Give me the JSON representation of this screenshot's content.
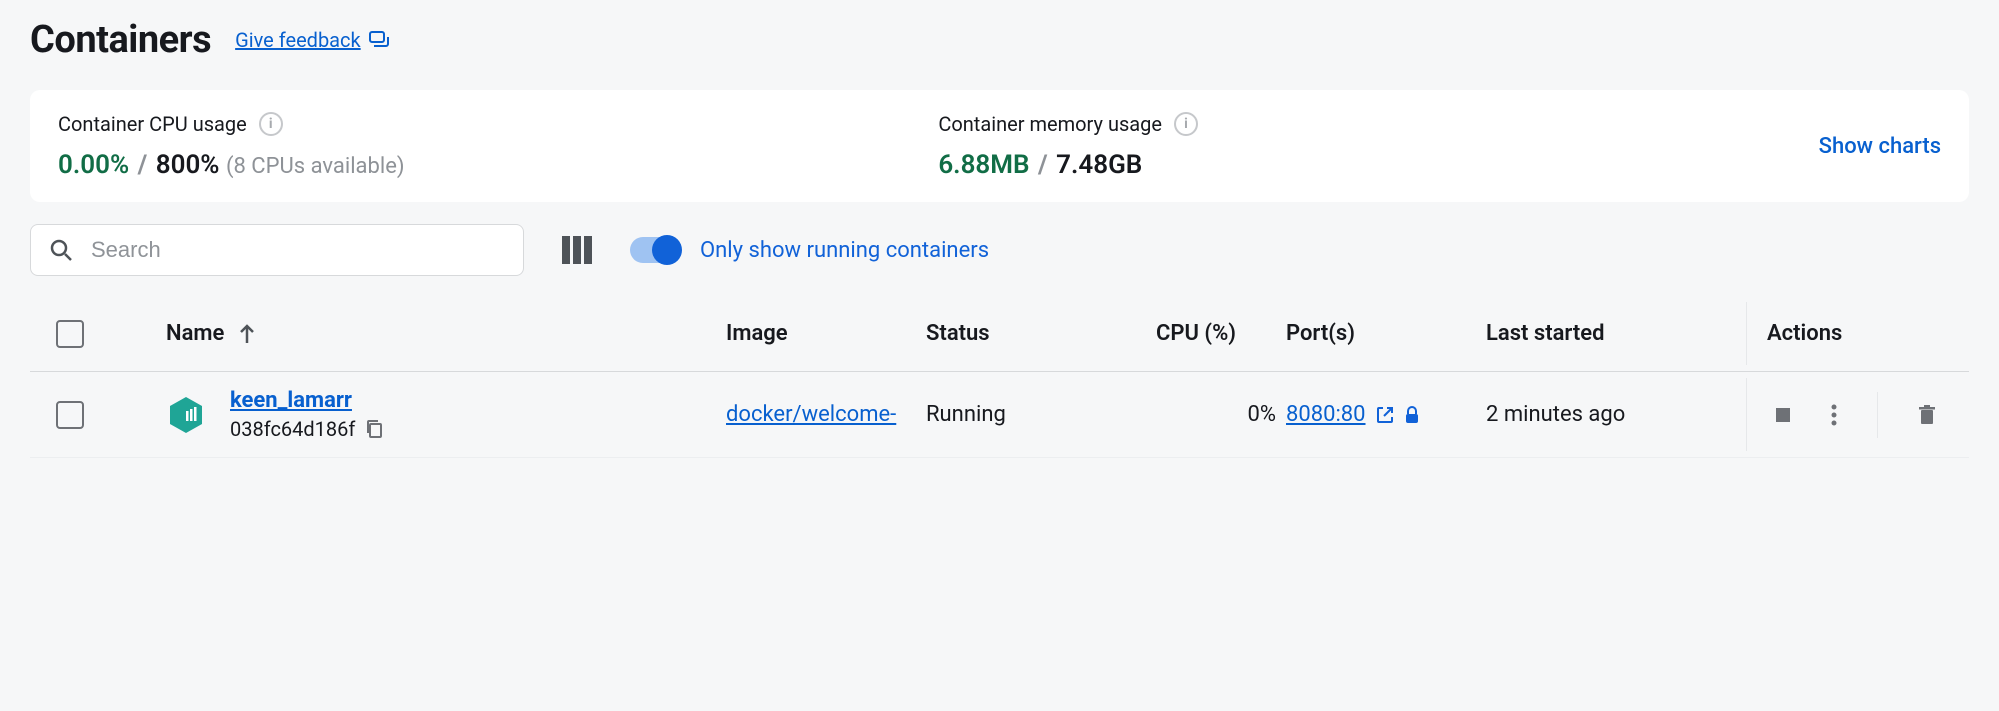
{
  "header": {
    "title": "Containers",
    "feedback_label": "Give feedback"
  },
  "stats": {
    "cpu": {
      "label": "Container CPU usage",
      "used": "0.00%",
      "slash": "/",
      "total": "800%",
      "note": "(8 CPUs available)"
    },
    "memory": {
      "label": "Container memory usage",
      "used": "6.88MB",
      "slash": "/",
      "total": "7.48GB"
    },
    "show_charts": "Show charts"
  },
  "toolbar": {
    "search_placeholder": "Search",
    "toggle_label": "Only show running containers"
  },
  "table": {
    "headers": {
      "name": "Name",
      "image": "Image",
      "status": "Status",
      "cpu": "CPU (%)",
      "ports": "Port(s)",
      "last_started": "Last started",
      "actions": "Actions"
    },
    "rows": [
      {
        "name": "keen_lamarr",
        "id": "038fc64d186f",
        "image": "docker/welcome-",
        "status": "Running",
        "cpu": "0%",
        "port": "8080:80",
        "last_started": "2 minutes ago"
      }
    ]
  }
}
